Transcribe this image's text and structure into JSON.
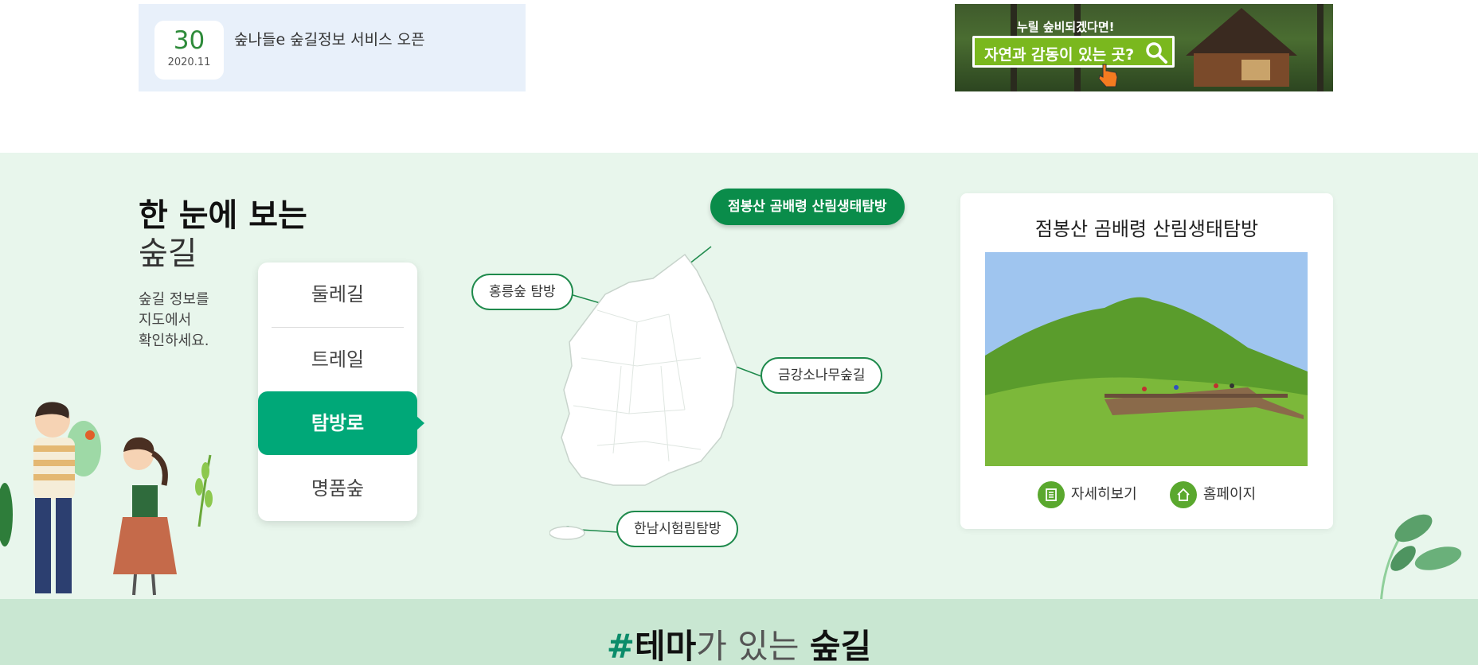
{
  "notice": {
    "day": "30",
    "year_month": "2020.11",
    "title": "숲나들e 숲길정보 서비스 오픈"
  },
  "banner": {
    "small_text": "누릴 숲비되겠다면!",
    "main_text": "자연과 감동이 있는 곳?"
  },
  "map_section": {
    "heading_strong": "한 눈에 보는",
    "heading_light": "숲길",
    "description": [
      "숲길 정보를",
      "지도에서",
      "확인하세요."
    ],
    "tabs": [
      {
        "label": "둘레길",
        "active": false
      },
      {
        "label": "트레일",
        "active": false
      },
      {
        "label": "탐방로",
        "active": true
      },
      {
        "label": "명품숲",
        "active": false
      }
    ],
    "pins": [
      {
        "label": "점봉산 곰배령 산림생태탐방",
        "active": true
      },
      {
        "label": "홍릉숲 탐방",
        "active": false
      },
      {
        "label": "금강소나무숲길",
        "active": false
      },
      {
        "label": "한남시험림탐방",
        "active": false
      }
    ]
  },
  "info_card": {
    "title": "점봉산 곰배령 산림생태탐방",
    "detail_label": "자세히보기",
    "homepage_label": "홈페이지"
  },
  "theme_section": {
    "hash": "#",
    "strong1": "테마",
    "light": "가 있는 ",
    "strong2": "숲길"
  },
  "colors": {
    "accent_green": "#00a878",
    "pin_active": "#0a8c4a",
    "map_bg": "#e8f6ec",
    "theme_bg": "#c9e7d2",
    "notice_bg": "#e8f0fa"
  }
}
